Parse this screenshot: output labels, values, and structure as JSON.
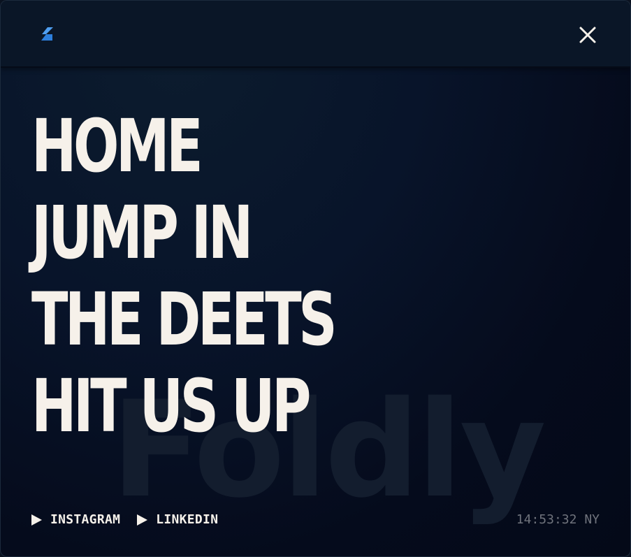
{
  "header": {
    "logo_icon": "foldly-logo-icon",
    "close_icon": "close-icon",
    "accent_color": "#3a8ee8"
  },
  "menu": {
    "items": [
      {
        "label": "HOME"
      },
      {
        "label": "JUMP IN"
      },
      {
        "label": "THE DEETS"
      },
      {
        "label": "HIT US UP"
      }
    ]
  },
  "watermark": "Foldly",
  "socials": [
    {
      "icon": "play-icon",
      "label": "INSTAGRAM"
    },
    {
      "icon": "play-icon",
      "label": "LINKEDIN"
    }
  ],
  "clock": "14:53:32 NY",
  "colors": {
    "text": "#f6f1ea",
    "background": "#050b1c",
    "muted": "#6f737c"
  }
}
